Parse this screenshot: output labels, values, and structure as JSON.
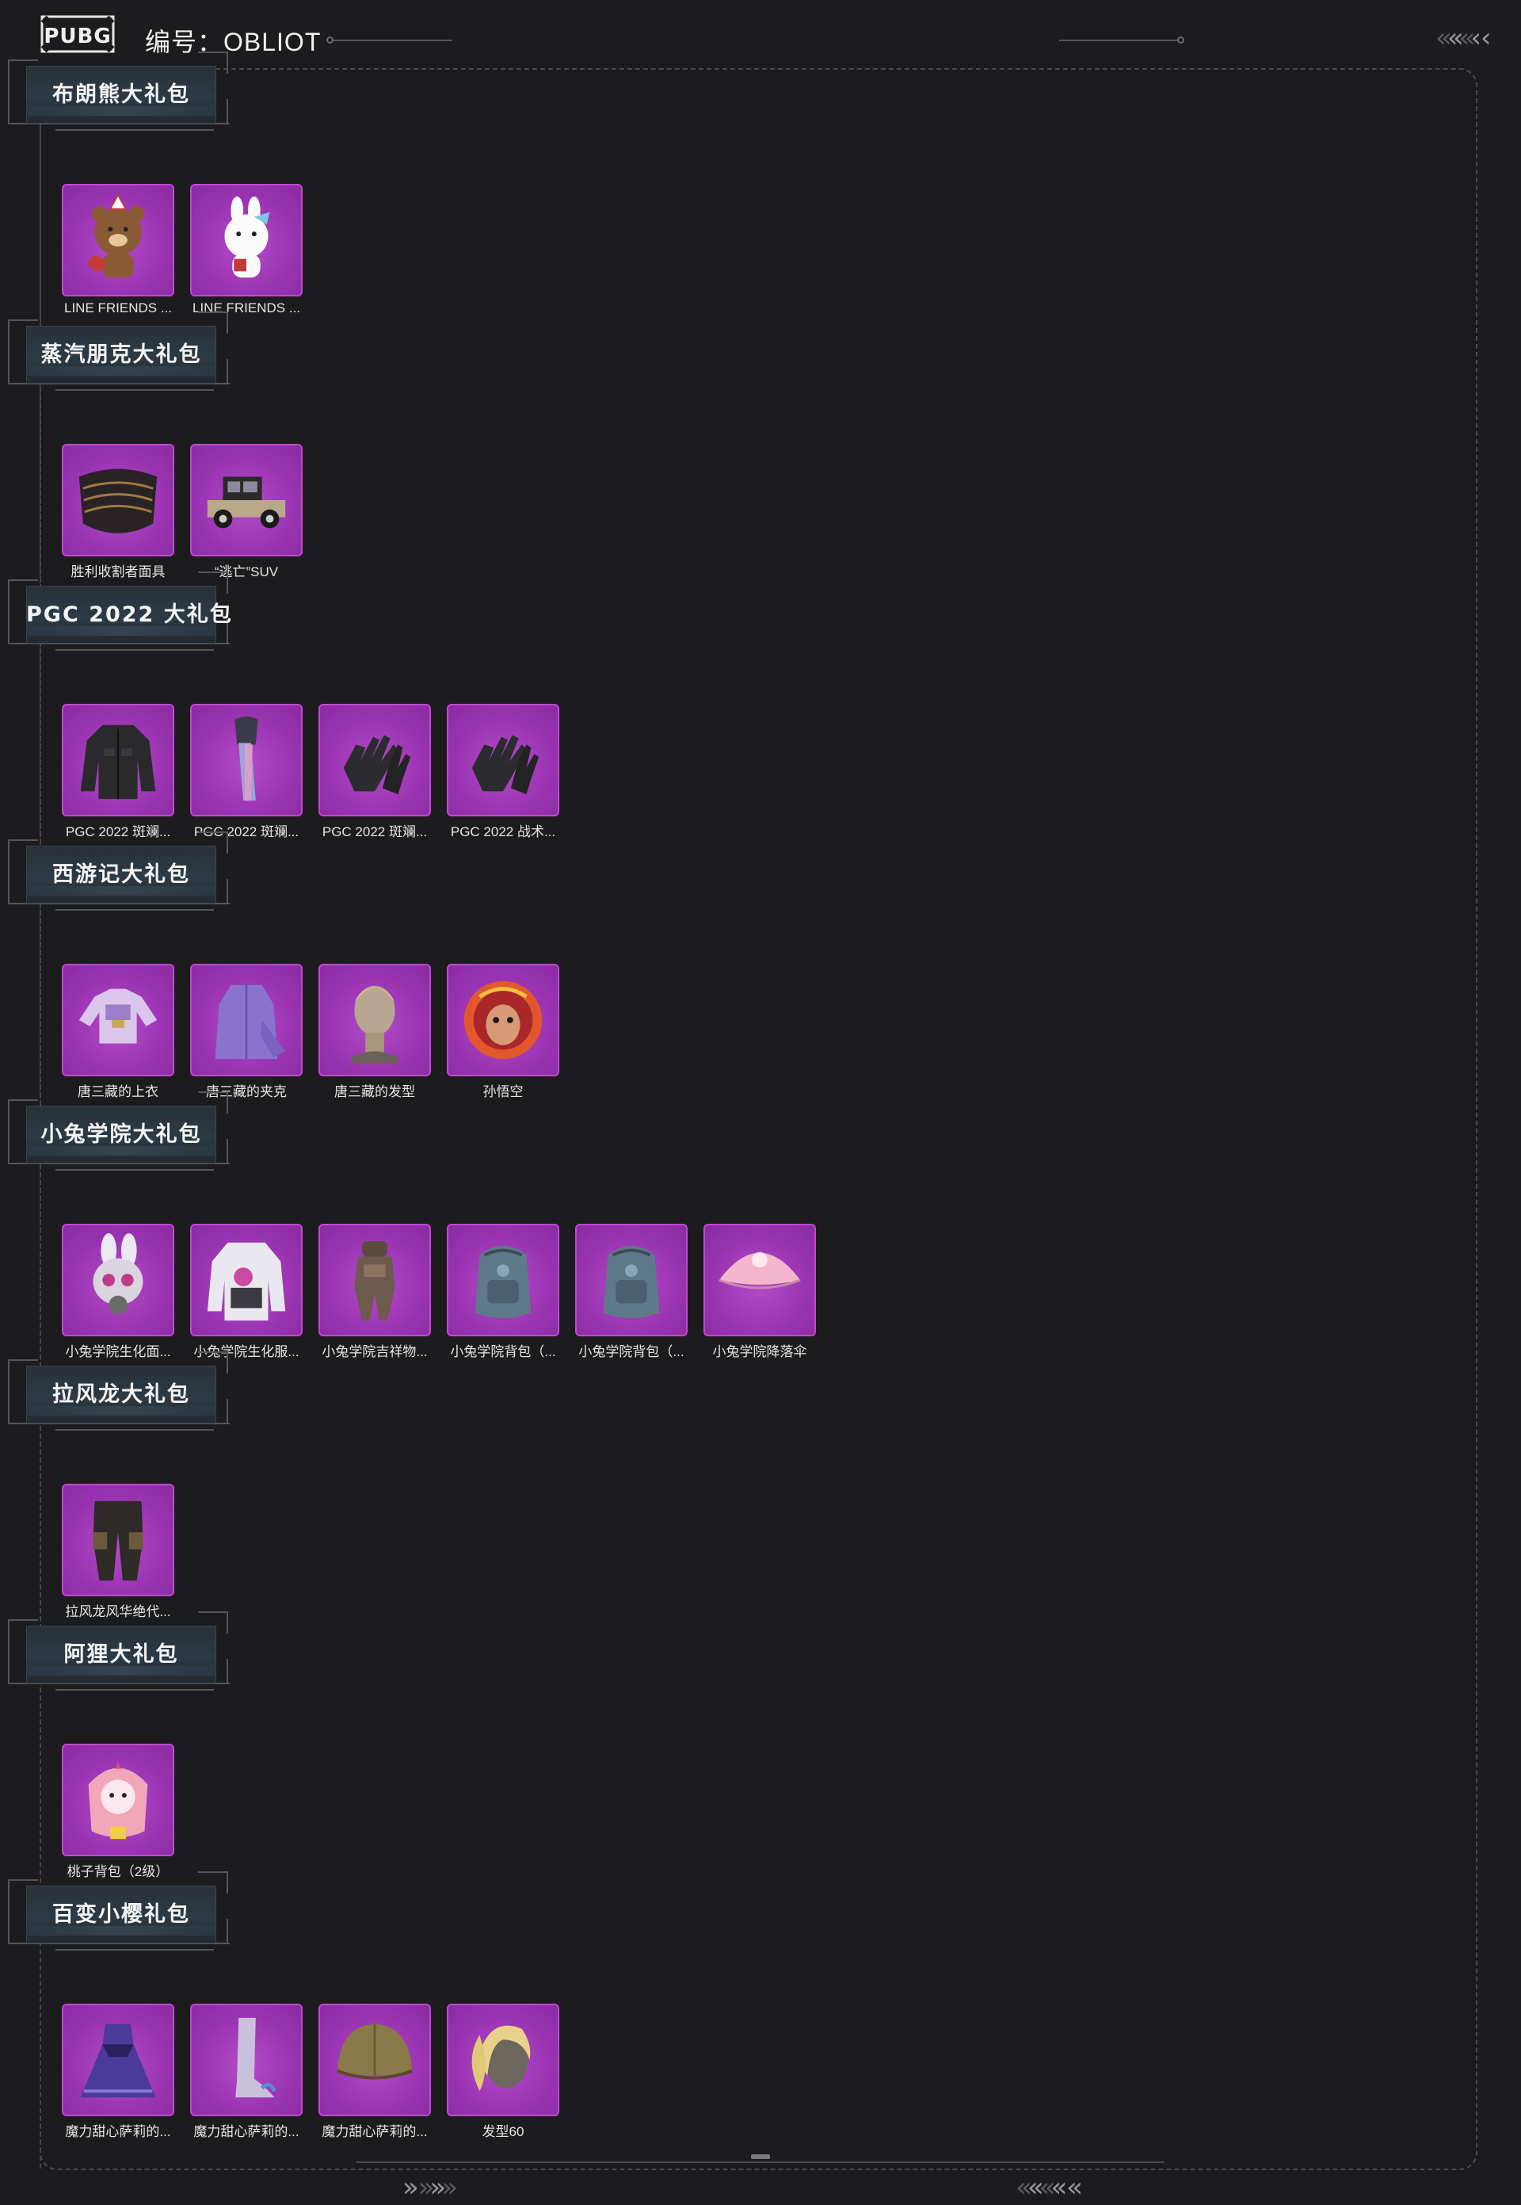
{
  "header": {
    "logo_text": "PUBG",
    "title": "编号：OBLIOT"
  },
  "sections": [
    {
      "title": "布朗熊大礼包",
      "items": [
        {
          "name": "LINE FRIENDS ...",
          "icon": "brown-bear-icon"
        },
        {
          "name": "LINE FRIENDS ...",
          "icon": "cony-rabbit-icon"
        }
      ]
    },
    {
      "title": "蒸汽朋克大礼包",
      "items": [
        {
          "name": "胜利收割者面具",
          "icon": "mask-icon"
        },
        {
          "name": "“逃亡”SUV",
          "icon": "vintage-car-icon"
        }
      ]
    },
    {
      "title": "PGC 2022 大礼包",
      "items": [
        {
          "name": "PGC 2022 斑斓...",
          "icon": "tactical-jacket-icon"
        },
        {
          "name": "PGC 2022 斑斓...",
          "icon": "scarf-icon"
        },
        {
          "name": "PGC 2022 斑斓...",
          "icon": "gloves-icon"
        },
        {
          "name": "PGC 2022 战术...",
          "icon": "gloves-icon"
        }
      ]
    },
    {
      "title": "西游记大礼包",
      "items": [
        {
          "name": "唐三藏的上衣",
          "icon": "top-icon"
        },
        {
          "name": "唐三藏的夹克",
          "icon": "robe-icon"
        },
        {
          "name": "唐三藏的发型",
          "icon": "head-icon"
        },
        {
          "name": "孙悟空",
          "icon": "monkey-king-icon"
        }
      ]
    },
    {
      "title": "小兔学院大礼包",
      "items": [
        {
          "name": "小兔学院生化面...",
          "icon": "gas-mask-icon"
        },
        {
          "name": "小兔学院生化服...",
          "icon": "hazmat-suit-icon"
        },
        {
          "name": "小兔学院吉祥物...",
          "icon": "mascot-suit-icon"
        },
        {
          "name": "小兔学院背包（...",
          "icon": "backpack-icon"
        },
        {
          "name": "小兔学院背包（...",
          "icon": "backpack-icon"
        },
        {
          "name": "小兔学院降落伞",
          "icon": "parachute-icon"
        }
      ]
    },
    {
      "title": "拉风龙大礼包",
      "items": [
        {
          "name": "拉风龙风华绝代...",
          "icon": "pants-icon"
        }
      ]
    },
    {
      "title": "阿狸大礼包",
      "items": [
        {
          "name": "桃子背包（2级）",
          "icon": "peach-backpack-icon"
        }
      ]
    },
    {
      "title": "百变小樱礼包",
      "items": [
        {
          "name": "魔力甜心萨莉的...",
          "icon": "dress-icon"
        },
        {
          "name": "魔力甜心萨莉的...",
          "icon": "boots-icon"
        },
        {
          "name": "魔力甜心萨莉的...",
          "icon": "helmet-icon"
        },
        {
          "name": "发型60",
          "icon": "hairstyle-icon"
        }
      ]
    }
  ],
  "colors": {
    "background": "#1c1c1e",
    "tile": "#a03ab8",
    "tile_border": "#c04ad0",
    "badge": "#2d3a44"
  }
}
